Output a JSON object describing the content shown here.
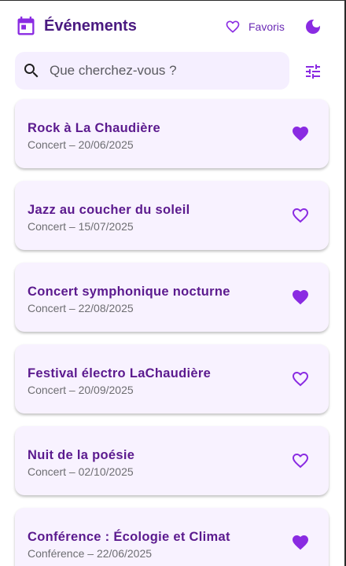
{
  "header": {
    "title": "Événements",
    "favorites_label": "Favoris",
    "calendar_icon": "calendar-icon",
    "theme_icon": "dark-mode-moon-icon",
    "favorites_icon": "heart-outline-icon"
  },
  "search": {
    "placeholder": "Que cherchez-vous ?",
    "value": "",
    "icon": "search-icon",
    "filter_icon": "tune-sliders-icon"
  },
  "colors": {
    "accent": "#8a2be2",
    "title": "#4a1a80",
    "card_background": "#f8f2ff",
    "search_background": "#f5efff"
  },
  "events": [
    {
      "title": "Rock à La Chaudière",
      "category": "Concert",
      "date": "20/06/2025",
      "subtitle": "Concert – 20/06/2025",
      "favorite": true
    },
    {
      "title": "Jazz au coucher du soleil",
      "category": "Concert",
      "date": "15/07/2025",
      "subtitle": "Concert – 15/07/2025",
      "favorite": false
    },
    {
      "title": "Concert symphonique nocturne",
      "category": "Concert",
      "date": "22/08/2025",
      "subtitle": "Concert – 22/08/2025",
      "favorite": true
    },
    {
      "title": "Festival électro LaChaudière",
      "category": "Concert",
      "date": "20/09/2025",
      "subtitle": "Concert – 20/09/2025",
      "favorite": false
    },
    {
      "title": "Nuit de la poésie",
      "category": "Concert",
      "date": "02/10/2025",
      "subtitle": "Concert – 02/10/2025",
      "favorite": false
    },
    {
      "title": "Conférence : Écologie et Climat",
      "category": "Conférence",
      "date": "22/06/2025",
      "subtitle": "Conférence – 22/06/2025",
      "favorite": true
    }
  ]
}
